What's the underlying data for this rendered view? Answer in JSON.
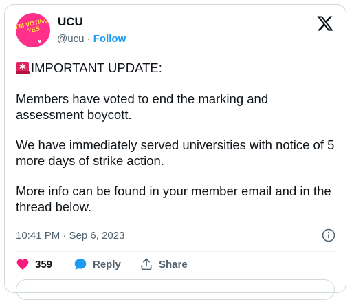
{
  "author": {
    "avatar_text": "I'M VOTING YES",
    "name": "UCU",
    "handle": "@ucu",
    "separator": "·",
    "follow_label": "Follow"
  },
  "icons": {
    "logo": "x-logo-icon",
    "siren": "police-light-icon",
    "info": "info-icon",
    "like": "heart-icon",
    "reply": "speech-bubble-icon",
    "share": "share-icon"
  },
  "tweet": {
    "headline": "IMPORTANT UPDATE:",
    "paragraph1": "Members have voted to end the marking and assessment boycott.",
    "paragraph2": "We have immediately served universities with notice of 5 more days of strike action.",
    "paragraph3": "More info can be found in your member email and in the thread below.",
    "timestamp": "10:41 PM · Sep 6, 2023"
  },
  "actions": {
    "like_count": "359",
    "reply_label": "Reply",
    "share_label": "Share"
  },
  "colors": {
    "accent": "#1d9bf0",
    "like": "#f91880",
    "avatar_bg": "#ff2f8a",
    "avatar_text": "#ffe23a",
    "muted": "#536471"
  }
}
